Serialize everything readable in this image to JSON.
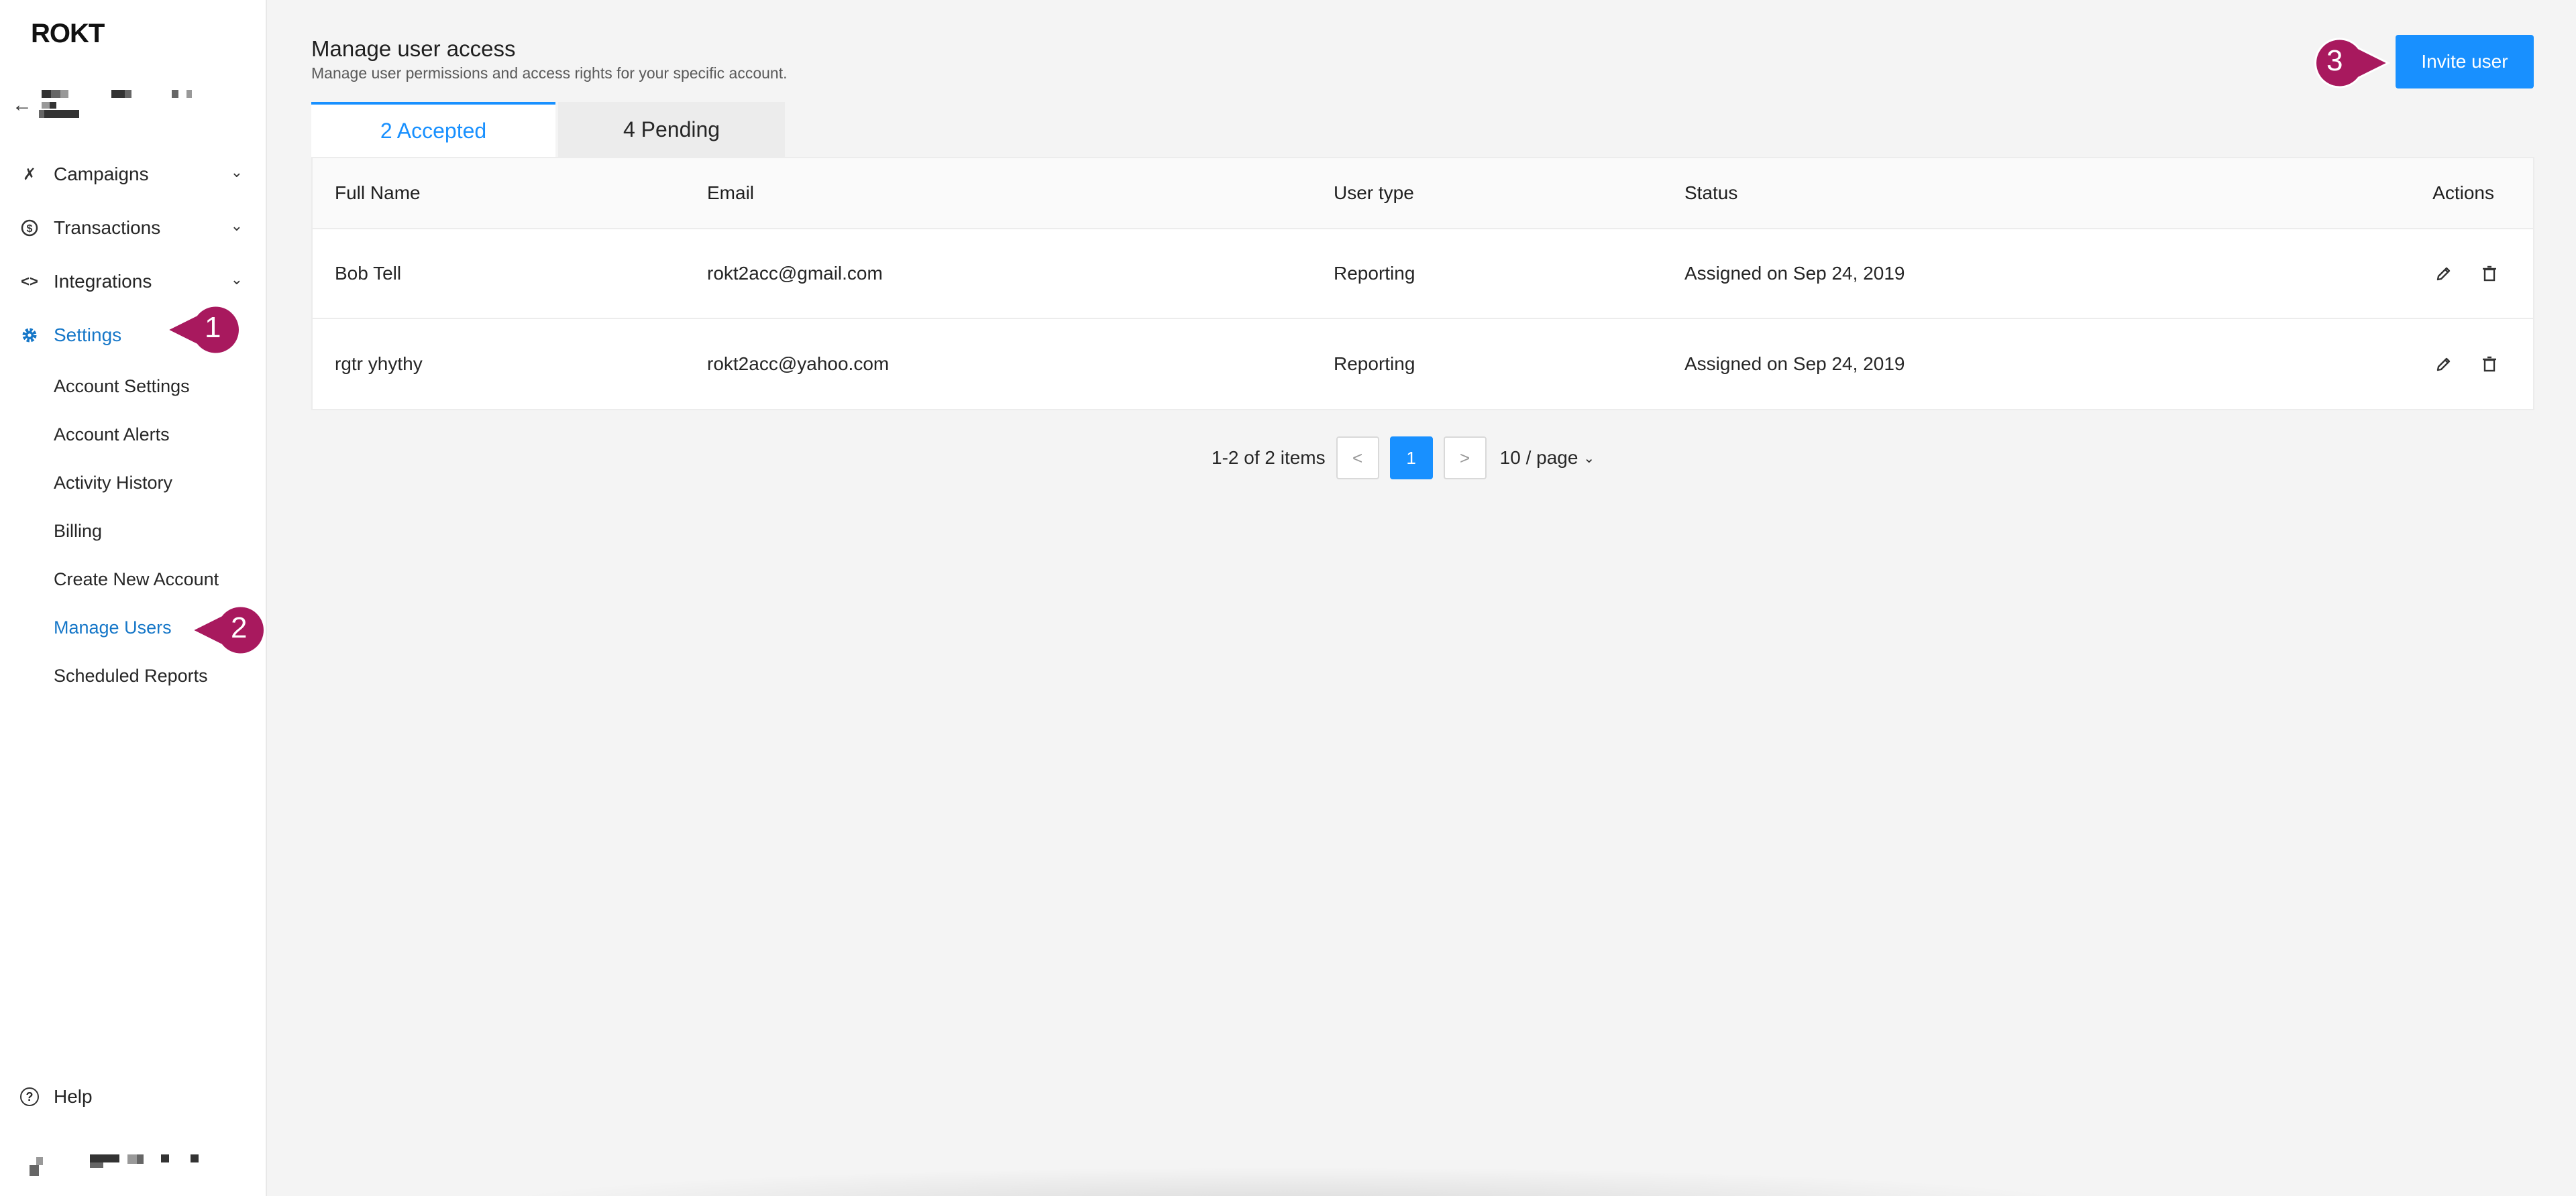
{
  "app": {
    "logo": "ROKT"
  },
  "sidebar": {
    "nav": [
      {
        "label": "Campaigns",
        "icon": "megaphone-icon"
      },
      {
        "label": "Transactions",
        "icon": "dollar-icon"
      },
      {
        "label": "Integrations",
        "icon": "code-icon"
      },
      {
        "label": "Settings",
        "icon": "gear-icon"
      }
    ],
    "settings_items": [
      "Account Settings",
      "Account Alerts",
      "Activity History",
      "Billing",
      "Create New Account",
      "Manage Users",
      "Scheduled Reports"
    ],
    "active_item": "Manage Users",
    "help_label": "Help"
  },
  "header": {
    "title": "Manage user access",
    "subtitle": "Manage user permissions and access rights for your specific account.",
    "invite_label": "Invite user"
  },
  "tabs": [
    {
      "label": "2 Accepted",
      "active": true
    },
    {
      "label": "4 Pending",
      "active": false
    }
  ],
  "table": {
    "columns": [
      "Full Name",
      "Email",
      "User type",
      "Status",
      "Actions"
    ],
    "rows": [
      {
        "name": "Bob Tell",
        "email": "rokt2acc@gmail.com",
        "type": "Reporting",
        "status": "Assigned on Sep 24, 2019"
      },
      {
        "name": "rgtr yhythy",
        "email": "rokt2acc@yahoo.com",
        "type": "Reporting",
        "status": "Assigned on Sep 24, 2019"
      }
    ]
  },
  "pagination": {
    "summary": "1-2 of 2 items",
    "current_page": "1",
    "page_size": "10 / page"
  },
  "callouts": [
    "1",
    "2",
    "3"
  ],
  "colors": {
    "accent": "#1890ff",
    "callout": "#a8195e"
  }
}
